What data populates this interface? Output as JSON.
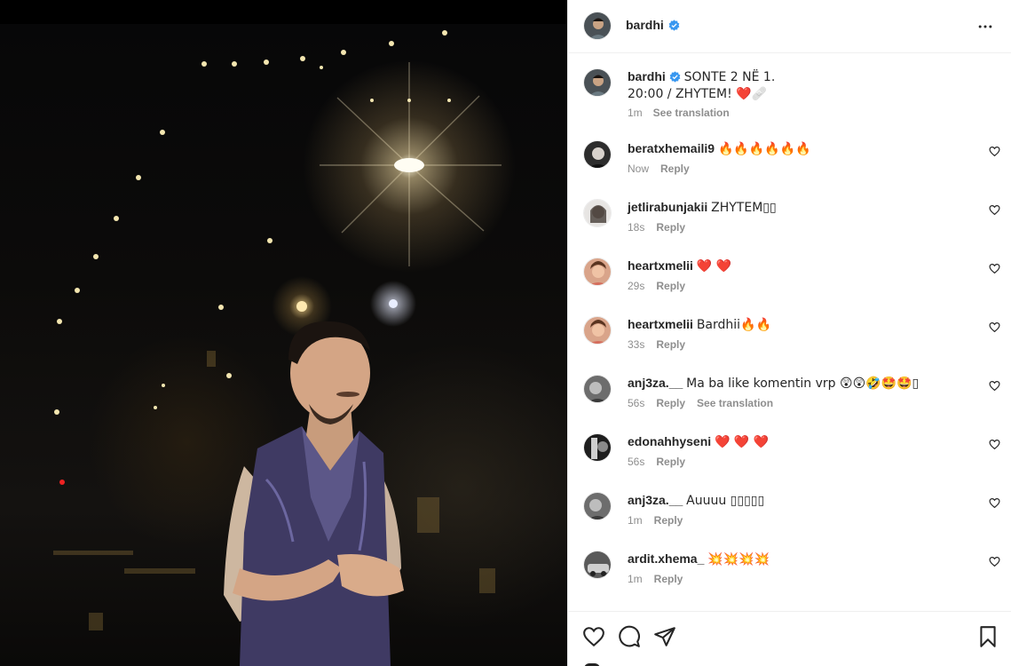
{
  "post": {
    "author": "bardhi",
    "verified": true
  },
  "caption": {
    "username": "bardhi",
    "text": "SONTE 2 NË 1. 20:00 / ZHYTEM! ❤️🩹",
    "time": "1m",
    "see_translation": "See translation"
  },
  "comments": [
    {
      "username": "beratxhemaili9",
      "text": "🔥🔥🔥🔥🔥🔥",
      "time": "Now",
      "reply": "Reply"
    },
    {
      "username": "jetlirabunjakii",
      "text": "ZHYTEM▯▯",
      "time": "18s",
      "reply": "Reply"
    },
    {
      "username": "heartxmelii",
      "text": "❤️ ❤️",
      "time": "29s",
      "reply": "Reply"
    },
    {
      "username": "heartxmelii",
      "text": "Bardhii🔥🔥",
      "time": "33s",
      "reply": "Reply"
    },
    {
      "username": "anj3za.__",
      "text": "Ma ba like komentin vrp 😲😲🤣🤩🤩▯",
      "time": "56s",
      "reply": "Reply",
      "see_translation": "See translation"
    },
    {
      "username": "edonahhyseni",
      "text": "❤️ ❤️ ❤️",
      "time": "56s",
      "reply": "Reply"
    },
    {
      "username": "anj3za.__",
      "text": "Auuuu ▯▯▯▯▯",
      "time": "1m",
      "reply": "Reply"
    },
    {
      "username": "ardit.xhema_",
      "text": "💥💥💥💥",
      "time": "1m",
      "reply": "Reply"
    }
  ],
  "icons": {
    "more": "more-horizontal-icon",
    "like": "heart-outline-icon",
    "comment": "comment-bubble-icon",
    "share": "paper-plane-icon",
    "save": "bookmark-icon",
    "verified": "verified-badge-icon"
  },
  "colors": {
    "verified_blue": "#3897f0",
    "meta_gray": "#8e8e8e",
    "text": "#262626",
    "heart_red": "#ed4956"
  }
}
